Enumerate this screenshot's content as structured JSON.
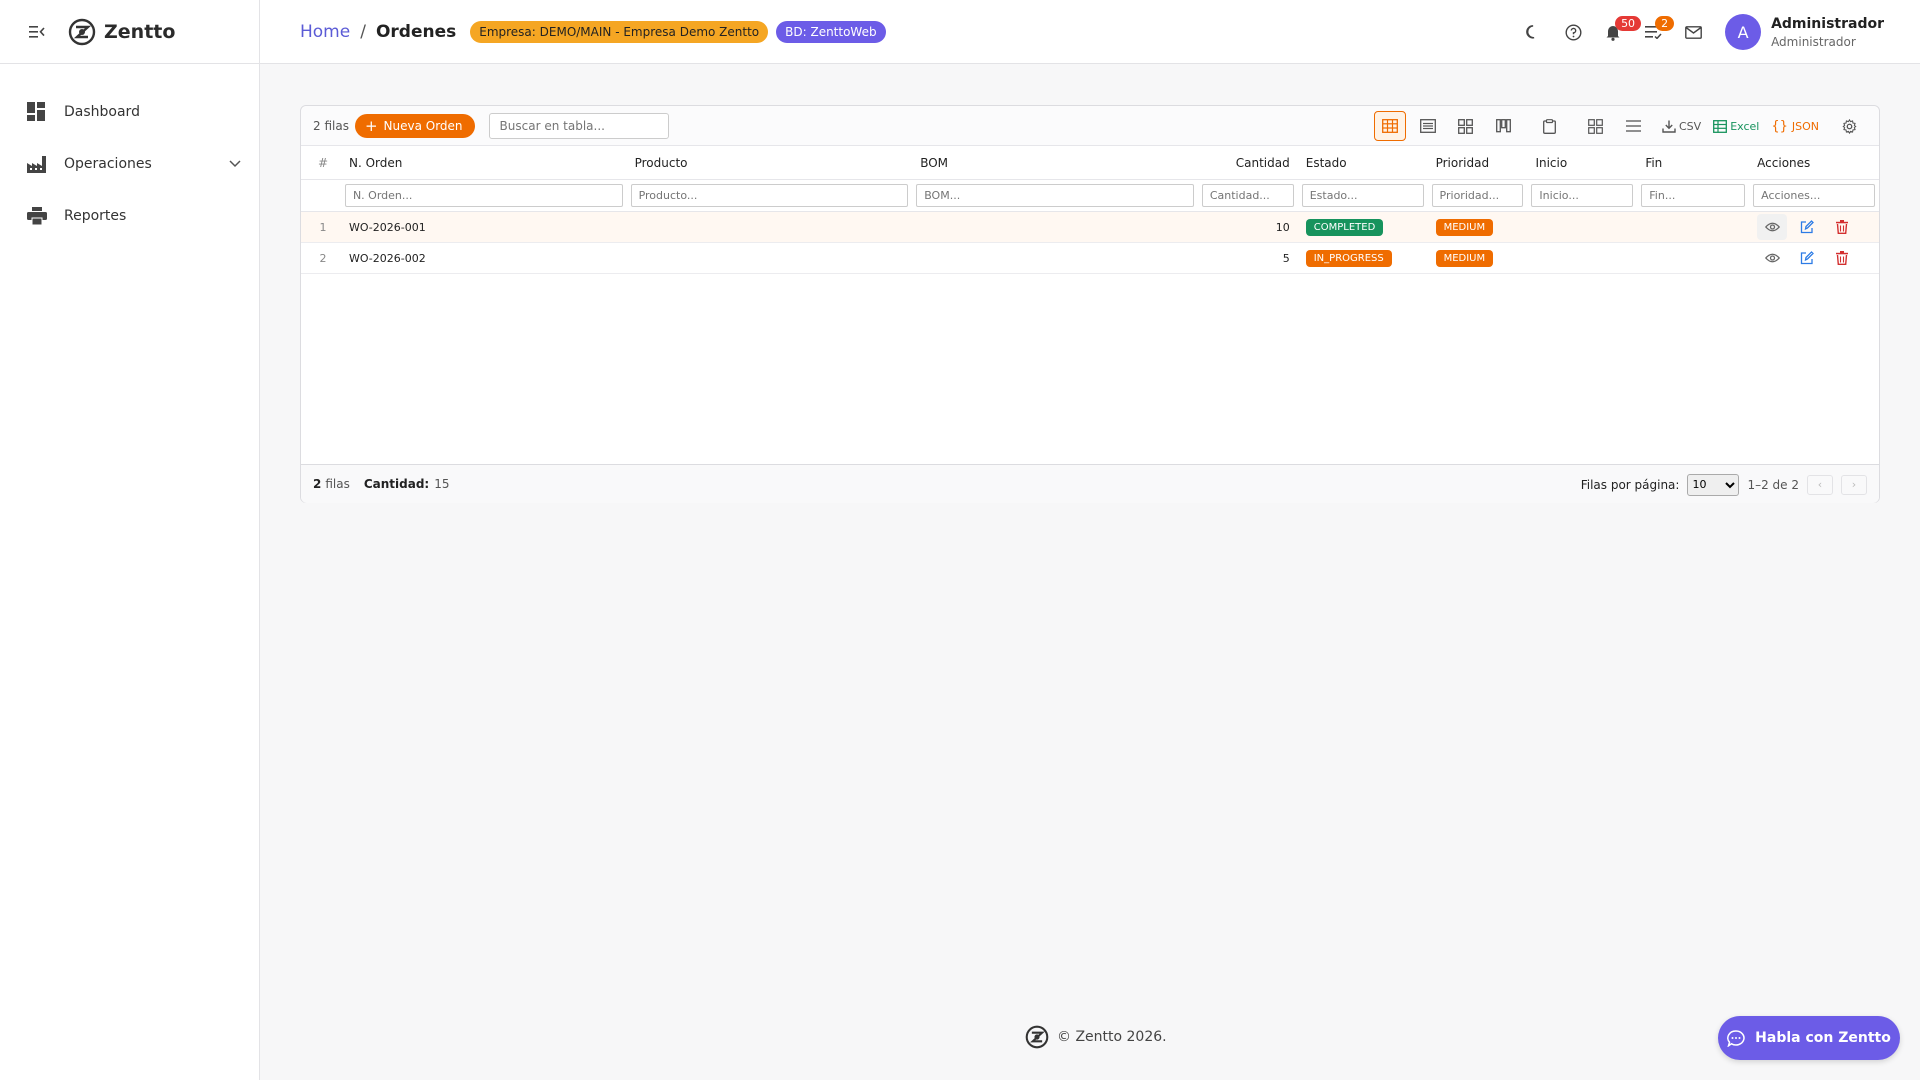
{
  "app": {
    "brand": "Zentto"
  },
  "sidebar": {
    "items": [
      {
        "label": "Dashboard",
        "icon": "dashboard-icon"
      },
      {
        "label": "Operaciones",
        "icon": "factory-icon",
        "expandable": true
      },
      {
        "label": "Reportes",
        "icon": "printer-icon"
      }
    ]
  },
  "header": {
    "breadcrumb": {
      "home": "Home",
      "separator": "/",
      "current": "Ordenes"
    },
    "empresa_pill": "Empresa: DEMO/MAIN - Empresa Demo Zentto",
    "bd_pill": "BD: ZenttoWeb",
    "notifications_count": "50",
    "tasks_count": "2",
    "user": {
      "avatar_letter": "A",
      "name": "Administrador",
      "role": "Administrador"
    }
  },
  "toolbar": {
    "row_count": "2 filas",
    "new_button": "Nueva Orden",
    "search_placeholder": "Buscar en tabla...",
    "csv_label": "CSV",
    "excel_label": "Excel",
    "json_label": "JSON"
  },
  "table": {
    "columns": {
      "idx": "#",
      "order": "N. Orden",
      "product": "Producto",
      "bom": "BOM",
      "qty": "Cantidad",
      "status": "Estado",
      "priority": "Prioridad",
      "start": "Inicio",
      "end": "Fin",
      "actions": "Acciones"
    },
    "filters": {
      "order": "N. Orden...",
      "product": "Producto...",
      "bom": "BOM...",
      "qty": "Cantidad...",
      "status": "Estado...",
      "priority": "Prioridad...",
      "start": "Inicio...",
      "end": "Fin...",
      "actions": "Acciones..."
    },
    "rows": [
      {
        "idx": "1",
        "order": "WO-2026-001",
        "product": "",
        "bom": "",
        "qty": "10",
        "status": "COMPLETED",
        "priority": "MEDIUM",
        "start": "",
        "end": ""
      },
      {
        "idx": "2",
        "order": "WO-2026-002",
        "product": "",
        "bom": "",
        "qty": "5",
        "status": "IN_PROGRESS",
        "priority": "MEDIUM",
        "start": "",
        "end": ""
      }
    ]
  },
  "footer": {
    "rows_num": "2",
    "rows_word": "filas",
    "qty_label": "Cantidad:",
    "qty_total": "15",
    "per_page_label": "Filas por página:",
    "per_page_value": "10",
    "range": "1–2 de 2",
    "prev": "‹",
    "next": "›"
  },
  "copyright": "© Zentto 2026.",
  "chat_button": "Habla con Zentto",
  "colors": {
    "accent_orange": "#ef6c00",
    "accent_purple": "#6c5ce7",
    "status_completed": "#17935d",
    "status_in_progress": "#ef6c00",
    "priority_medium": "#ef6c00"
  }
}
